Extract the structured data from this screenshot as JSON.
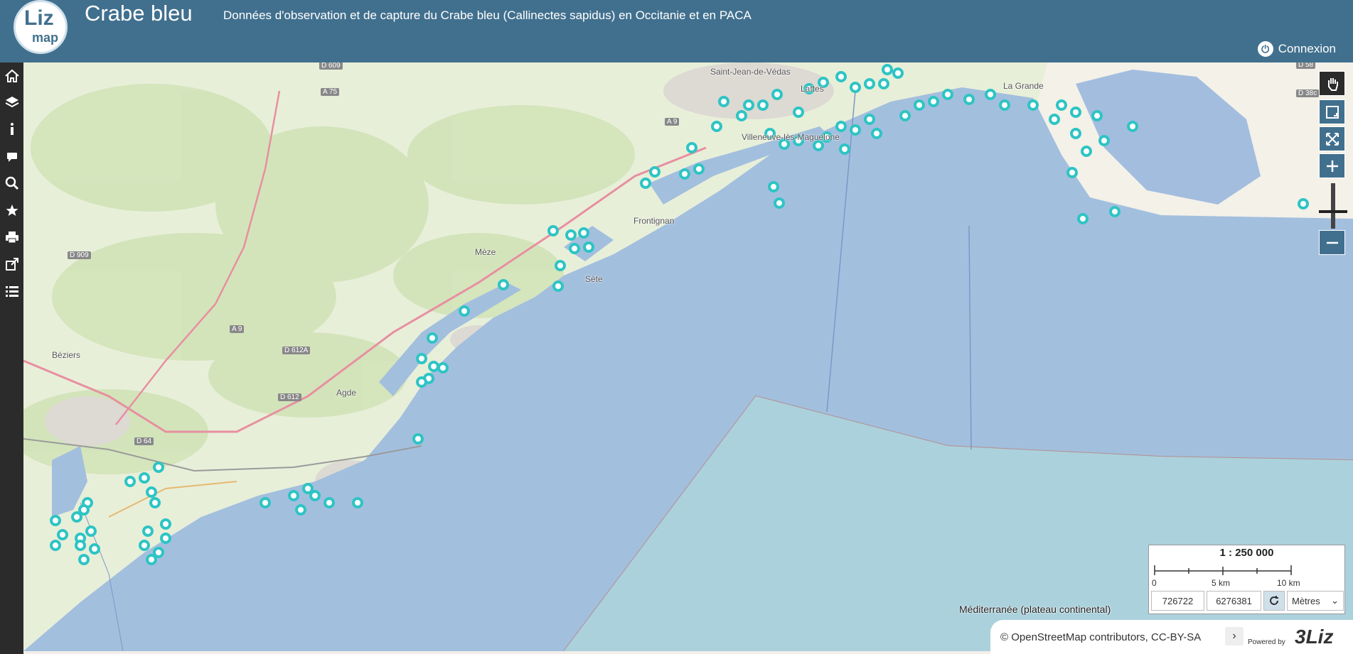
{
  "app": {
    "logo_top": "Liz",
    "logo_bottom": "map",
    "title": "Crabe bleu",
    "subtitle": "Données d'observation et de capture du Crabe bleu (Callinectes sapidus) en Occitanie et en PACA",
    "login_label": "Connexion"
  },
  "sidebar": {
    "items": [
      {
        "icon": "home-icon"
      },
      {
        "icon": "layers-icon"
      },
      {
        "icon": "info-icon"
      },
      {
        "icon": "comment-icon"
      },
      {
        "icon": "search-icon"
      },
      {
        "icon": "star-icon"
      },
      {
        "icon": "print-icon"
      },
      {
        "icon": "share-icon"
      },
      {
        "icon": "list-icon"
      }
    ]
  },
  "map": {
    "places": {
      "saint_jean": "Saint-Jean-de-Védas",
      "lattes": "Lattes",
      "la_grande": "La Grande",
      "villeneuve": "Villeneuve-lès-Maguelone",
      "frontignan": "Frontignan",
      "meze": "Mèze",
      "sete": "Sète",
      "beziers": "Béziers",
      "agde": "Agde"
    },
    "roads": {
      "d609": "D 609",
      "a75": "A 75",
      "a9a": "A 9",
      "a9b": "A 9",
      "d909": "D 909",
      "d612a": "D 612A",
      "d612": "D 612",
      "d64": "D 64",
      "d58": "D 58",
      "d38c": "D 38c"
    },
    "sea_label": "Méditerranée (plateau continental)",
    "sea_color": "#a3bfde",
    "point_color": "#2ec4c4"
  },
  "tools": {
    "pan_icon": "hand-icon",
    "zoom_box_icon": "zoom-box-icon",
    "fullscreen_icon": "extent-icon",
    "zoom_in_icon": "plus-icon",
    "zoom_out_icon": "minus-icon"
  },
  "scale": {
    "label": "1 : 250 000",
    "tick0": "0",
    "tick5": "5 km",
    "tick10": "10 km",
    "x": "726722",
    "y": "6276381",
    "unit": "Mètres"
  },
  "attribution": {
    "text": "© OpenStreetMap contributors, CC-BY-SA",
    "toggle": "›",
    "powered_by": "Powered by",
    "brand": "3Liz"
  }
}
